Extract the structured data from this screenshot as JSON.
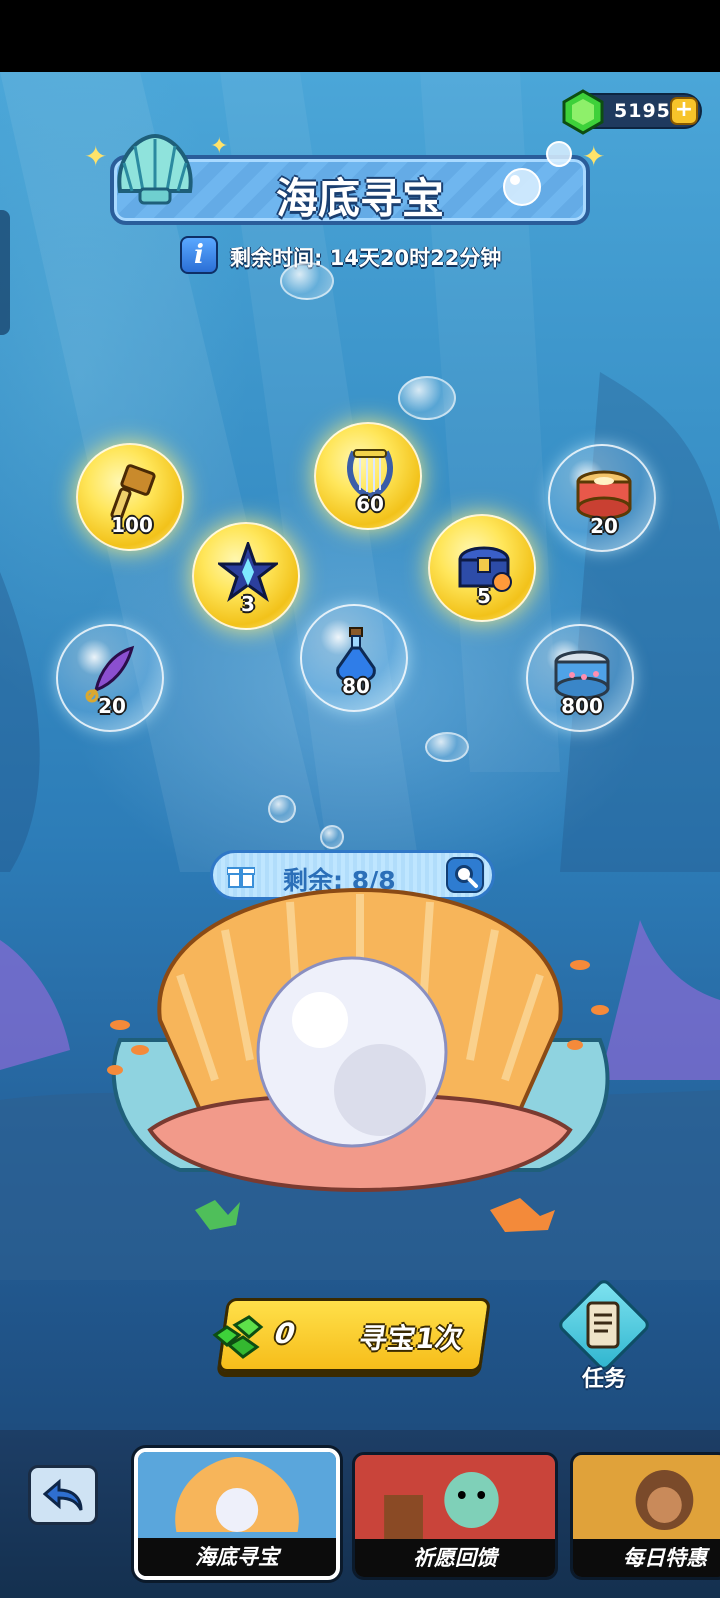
{
  "currency": {
    "amount": "5195",
    "icon": "green-gem-icon",
    "plus": "+"
  },
  "event": {
    "title": "海底寻宝",
    "timer_text": "剩余时间: 14天20时22分钟",
    "info_icon": "i"
  },
  "rewards": [
    {
      "icon": "hammer-icon",
      "count": "100",
      "highlight": true
    },
    {
      "icon": "lyre-icon",
      "count": "60",
      "highlight": true
    },
    {
      "icon": "cat-food-can-icon",
      "count": "20",
      "highlight": false
    },
    {
      "icon": "star-crystal-icon",
      "count": "3",
      "highlight": true
    },
    {
      "icon": "treasure-chest-icon",
      "count": "5",
      "highlight": true
    },
    {
      "icon": "feather-key-icon",
      "count": "20",
      "highlight": false
    },
    {
      "icon": "potion-bottle-icon",
      "count": "80",
      "highlight": false
    },
    {
      "icon": "fish-can-icon",
      "count": "800",
      "highlight": false
    }
  ],
  "remaining": {
    "label": "剩余: 8/8"
  },
  "hunt_button": {
    "cost": "0",
    "label": "寻宝1次"
  },
  "task_button": {
    "label": "任务"
  },
  "tabs": [
    {
      "label": "海底寻宝",
      "active": true
    },
    {
      "label": "祈愿回馈",
      "active": false
    },
    {
      "label": "每日特惠",
      "active": false
    }
  ],
  "colors": {
    "gold": "#f6bd1a",
    "ocean": "#3b93c9",
    "gem": "#3ed13a"
  }
}
